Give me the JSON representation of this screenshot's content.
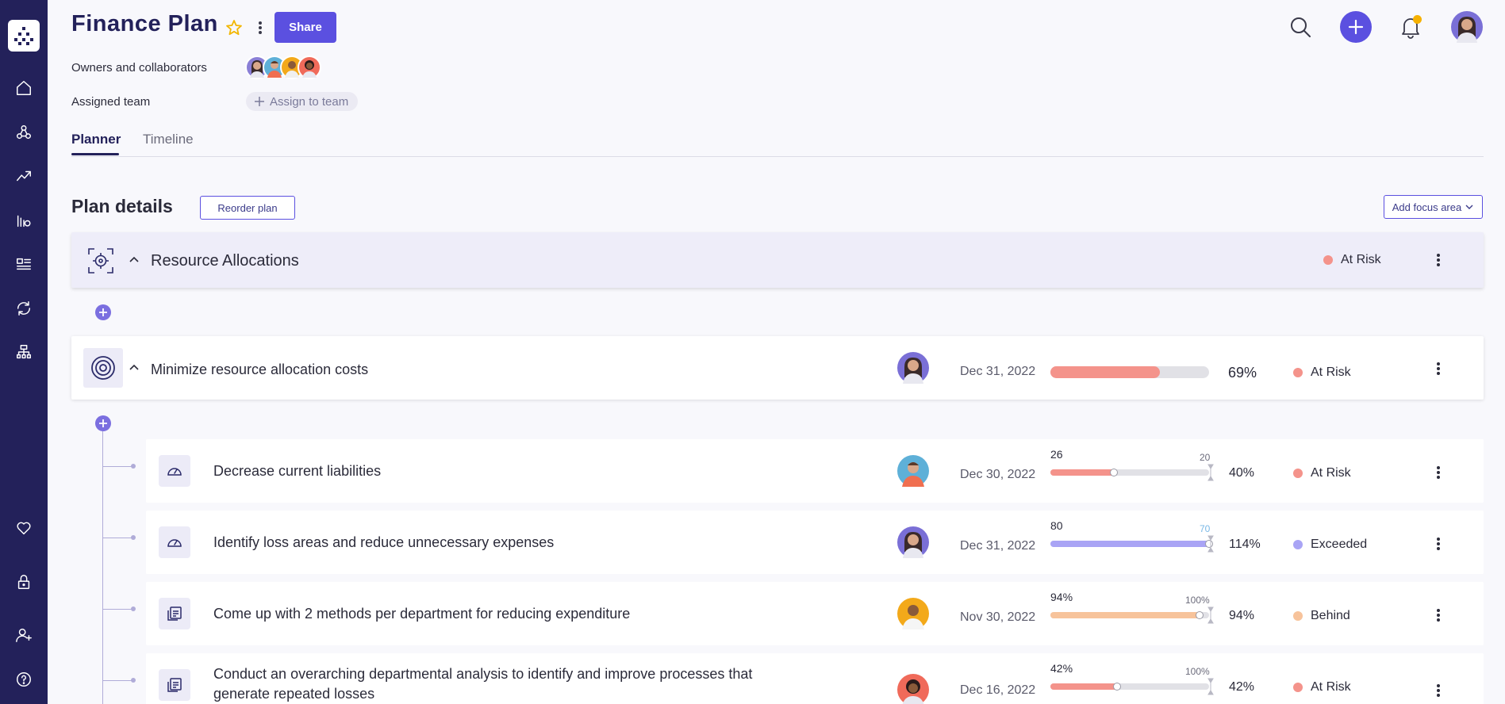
{
  "app": {
    "title": "Finance Plan",
    "share_label": "Share"
  },
  "colors": {
    "sidebar": "#23215a",
    "accent": "#5b50e0",
    "at_risk": "#f4938b",
    "exceeded": "#a9a4f5",
    "behind": "#f7c39b",
    "notify": "#f6b100"
  },
  "sidebar": {
    "items": [
      {
        "icon": "home-icon"
      },
      {
        "icon": "network-icon"
      },
      {
        "icon": "trending-up-icon"
      },
      {
        "icon": "bar-chart-icon"
      },
      {
        "icon": "list-icon"
      },
      {
        "icon": "refresh-icon"
      },
      {
        "icon": "hierarchy-icon"
      },
      {
        "icon": "heart-icon"
      },
      {
        "icon": "lock-icon"
      },
      {
        "icon": "add-user-icon"
      },
      {
        "icon": "help-icon"
      }
    ]
  },
  "header": {
    "owners_label": "Owners and collaborators",
    "team_label": "Assigned team",
    "assign_label": "Assign to team"
  },
  "tabs": [
    {
      "label": "Planner",
      "active": true
    },
    {
      "label": "Timeline",
      "active": false
    }
  ],
  "plan": {
    "title": "Plan details",
    "reorder_label": "Reorder plan",
    "add_focus_label": "Add focus area",
    "focus_area": {
      "title": "Resource Allocations",
      "status": "At Risk"
    },
    "objective": {
      "title": "Minimize resource allocation costs",
      "date": "Dec 31, 2022",
      "progress_pct": "69%",
      "progress": 0.69,
      "status": "At Risk"
    },
    "key_results": [
      {
        "title": "Decrease current liabilities",
        "date": "Dec 30, 2022",
        "current": "26",
        "target": "20",
        "pct": "40%",
        "progress": 0.4,
        "status": "At Risk",
        "status_color": "#f4938b",
        "icon": "gauge-icon"
      },
      {
        "title": "Identify loss areas and reduce unnecessary expenses",
        "date": "Dec 31, 2022",
        "current": "80",
        "target": "70",
        "pct": "114%",
        "progress": 1.0,
        "status": "Exceeded",
        "status_color": "#a9a4f5",
        "icon": "gauge-icon"
      },
      {
        "title": "Come up with 2 methods per department for reducing expenditure",
        "date": "Nov 30, 2022",
        "current": "94%",
        "target": "100%",
        "pct": "94%",
        "progress": 0.94,
        "status": "Behind",
        "status_color": "#f7c39b",
        "icon": "task-icon"
      },
      {
        "title": "Conduct an overarching departmental analysis to identify and improve processes that generate repeated losses",
        "date": "Dec 16, 2022",
        "current": "42%",
        "target": "100%",
        "pct": "42%",
        "progress": 0.42,
        "status": "At Risk",
        "status_color": "#f4938b",
        "icon": "task-icon"
      }
    ]
  }
}
